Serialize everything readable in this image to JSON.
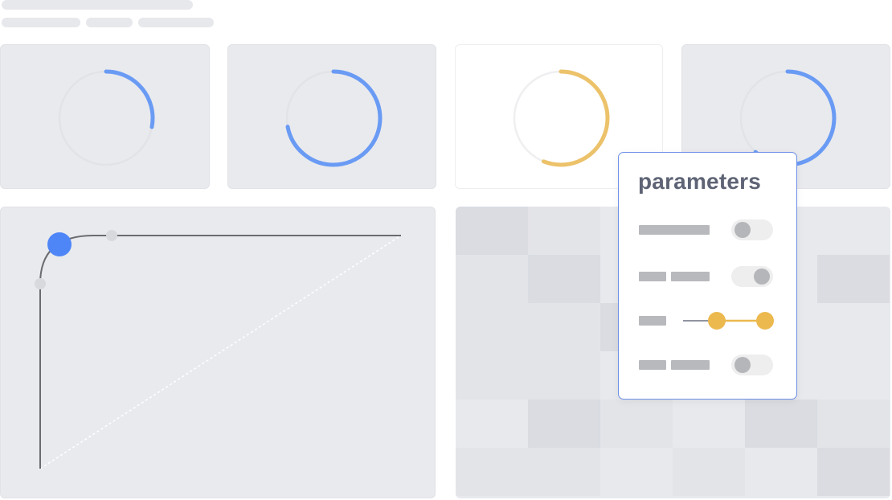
{
  "header": {
    "title_placeholder": "",
    "breadcrumb_placeholders": [
      "",
      "",
      ""
    ]
  },
  "gauges": [
    {
      "value": 0.28,
      "color": "#6a9bf4"
    },
    {
      "value": 0.72,
      "color": "#6a9bf4"
    },
    {
      "value": 0.56,
      "color": "#ecc26a"
    },
    {
      "value": 0.62,
      "color": "#6a9bf4"
    }
  ],
  "curve_editor": {
    "curve_color": "#6b6c70",
    "handle_color": "#4f86f7",
    "diagonal_color": "#ffffff"
  },
  "heatmap": {
    "colors": [
      "#dadce2",
      "#e3e4e8",
      "#e8e9ed"
    ]
  },
  "parameters_panel": {
    "title": "parameters",
    "rows": [
      {
        "type": "toggle",
        "value": "off"
      },
      {
        "type": "toggle",
        "value": "on"
      },
      {
        "type": "range-slider",
        "low": 0.35,
        "high": 0.9,
        "color": "#ecb94f"
      },
      {
        "type": "toggle",
        "value": "off"
      }
    ]
  }
}
